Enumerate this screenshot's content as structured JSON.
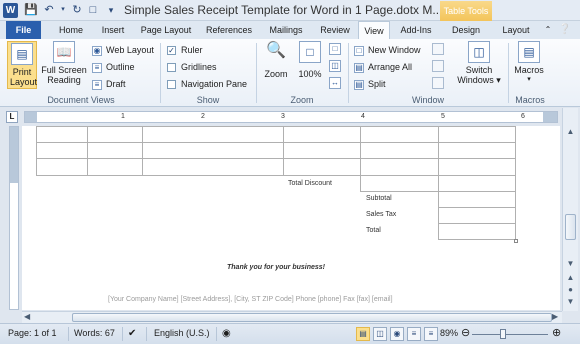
{
  "titlebar": {
    "app_icon_label": "W",
    "title": "Simple Sales Receipt Template for Word in 1 Page.dotx M...",
    "contextual_tab": "Table Tools"
  },
  "tabs": [
    "File",
    "Home",
    "Insert",
    "Page Layout",
    "References",
    "Mailings",
    "Review",
    "View",
    "Add-Ins",
    "Design",
    "Layout"
  ],
  "ribbon": {
    "document_views": {
      "label": "Document Views",
      "print_layout": "Print\nLayout",
      "print_layout_l1": "Print",
      "print_layout_l2": "Layout",
      "full_screen_l1": "Full Screen",
      "full_screen_l2": "Reading",
      "web_layout": "Web Layout",
      "outline": "Outline",
      "draft": "Draft"
    },
    "show": {
      "label": "Show",
      "ruler": "Ruler",
      "gridlines": "Gridlines",
      "navigation_pane": "Navigation Pane"
    },
    "zoom": {
      "label": "Zoom",
      "zoom": "Zoom",
      "percent": "100%"
    },
    "window": {
      "label": "Window",
      "new_window": "New Window",
      "arrange_all": "Arrange All",
      "split": "Split",
      "switch_l1": "Switch",
      "switch_l2": "Windows"
    },
    "macros": {
      "label": "Macros",
      "macros": "Macros"
    }
  },
  "ruler": {
    "numbers": [
      "1",
      "2",
      "3",
      "4",
      "5",
      "6"
    ]
  },
  "document": {
    "total_discount": "Total Discount",
    "subtotal": "Subtotal",
    "sales_tax": "Sales Tax",
    "total": "Total",
    "thanks": "Thank you for your business!",
    "footer": "[Your Company Name]  [Street Address], [City, ST  ZIP Code]  Phone [phone]  Fax [fax]  [email]"
  },
  "statusbar": {
    "page": "Page: 1 of 1",
    "words": "Words: 67",
    "language": "English (U.S.)",
    "zoom_percent": "89%"
  }
}
